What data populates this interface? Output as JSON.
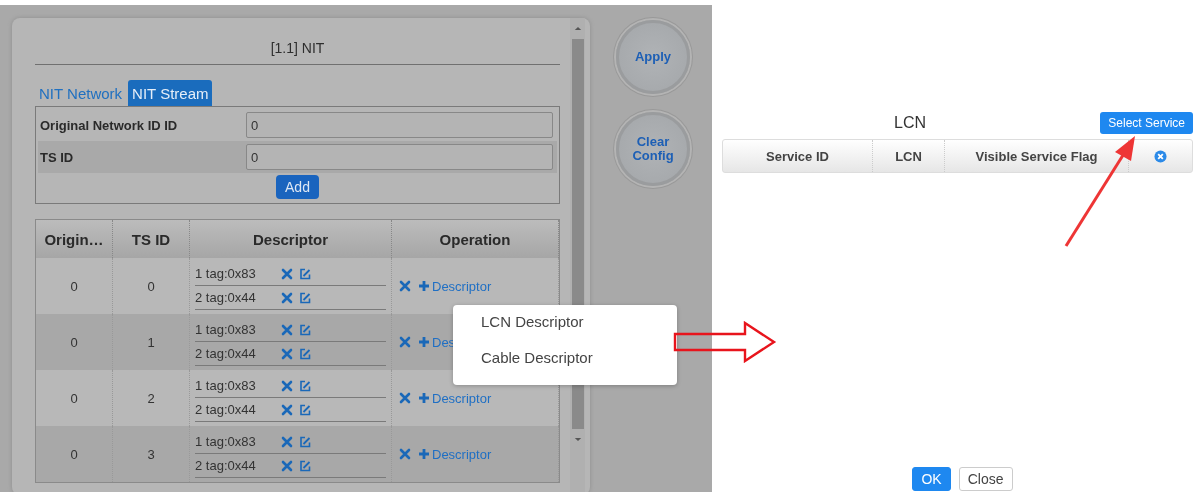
{
  "nit_panel": {
    "title": "[1.1] NIT",
    "tabs": [
      {
        "label": "NIT Network",
        "selected": false
      },
      {
        "label": "NIT Stream",
        "selected": true
      }
    ],
    "fields": [
      {
        "label": "Original Network ID ID",
        "value": "0"
      },
      {
        "label": "TS ID",
        "value": "0"
      }
    ],
    "add_button": "Add",
    "table": {
      "columns": [
        "Origin…",
        "TS ID",
        "Descriptor",
        "Operation"
      ],
      "rows": [
        {
          "original_network_id": "0",
          "ts_id": "0",
          "descriptors": [
            "1 tag:0x83",
            "2 tag:0x44"
          ],
          "operation": "Descriptor"
        },
        {
          "original_network_id": "0",
          "ts_id": "1",
          "descriptors": [
            "1 tag:0x83",
            "2 tag:0x44"
          ],
          "operation": "Des"
        },
        {
          "original_network_id": "0",
          "ts_id": "2",
          "descriptors": [
            "1 tag:0x83",
            "2 tag:0x44"
          ],
          "operation": "Descriptor"
        },
        {
          "original_network_id": "0",
          "ts_id": "3",
          "descriptors": [
            "1 tag:0x83",
            "2 tag:0x44"
          ],
          "operation": "Descriptor"
        }
      ]
    }
  },
  "side_buttons": [
    "Apply",
    "Clear Config"
  ],
  "context_menu": {
    "items": [
      "LCN Descriptor",
      "Cable Descriptor"
    ]
  },
  "lcn_dialog": {
    "title": "LCN",
    "select_button": "Select Service",
    "columns": [
      "Service ID",
      "LCN",
      "Visible Service Flag"
    ],
    "buttons": [
      {
        "label": "OK",
        "kind": "primary"
      },
      {
        "label": "Close",
        "kind": "default"
      }
    ]
  }
}
